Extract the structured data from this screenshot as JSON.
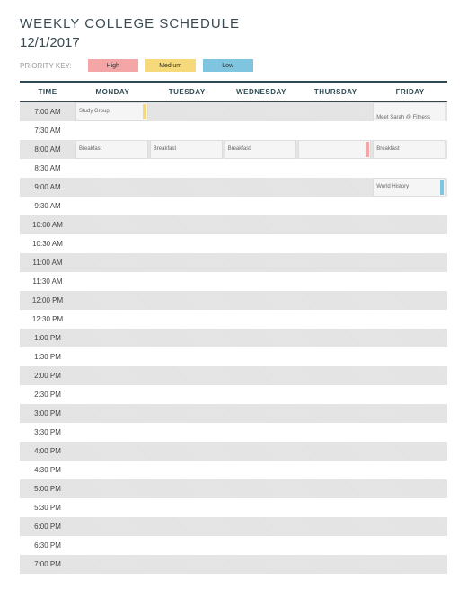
{
  "title": "WEEKLY COLLEGE SCHEDULE",
  "date": "12/1/2017",
  "legend": {
    "label": "PRIORITY KEY:",
    "high": "High",
    "medium": "Medium",
    "low": "Low"
  },
  "headers": {
    "time": "TIME",
    "days": [
      "MONDAY",
      "TUESDAY",
      "WEDNESDAY",
      "THURSDAY",
      "Friday"
    ]
  },
  "time_slots": [
    "7:00 AM",
    "7:30 AM",
    "8:00 AM",
    "8:30 AM",
    "9:00 AM",
    "9:30 AM",
    "10:00 AM",
    "10:30 AM",
    "11:00 AM",
    "11:30 AM",
    "12:00 PM",
    "12:30 PM",
    "1:00 PM",
    "1:30 PM",
    "2:00 PM",
    "2:30 PM",
    "3:00 PM",
    "3:30 PM",
    "4:00 PM",
    "4:30 PM",
    "5:00 PM",
    "5:30 PM",
    "6:00 PM",
    "6:30 PM",
    "7:00 PM"
  ],
  "events": {
    "mon_0": {
      "text": "Study Group",
      "priority": "medium"
    },
    "mon_2": {
      "text": "Breakfast",
      "priority": ""
    },
    "tue_2": {
      "text": "Breakfast",
      "priority": ""
    },
    "wed_2": {
      "text": "Breakfast",
      "priority": ""
    },
    "thu_2": {
      "text": "",
      "priority": "high"
    },
    "fri_0": {
      "text": "Meet Sarah @ Fitness Center",
      "priority": ""
    },
    "fri_2": {
      "text": "Breakfast",
      "priority": ""
    },
    "fri_4": {
      "text": "World History",
      "priority": "low"
    }
  }
}
